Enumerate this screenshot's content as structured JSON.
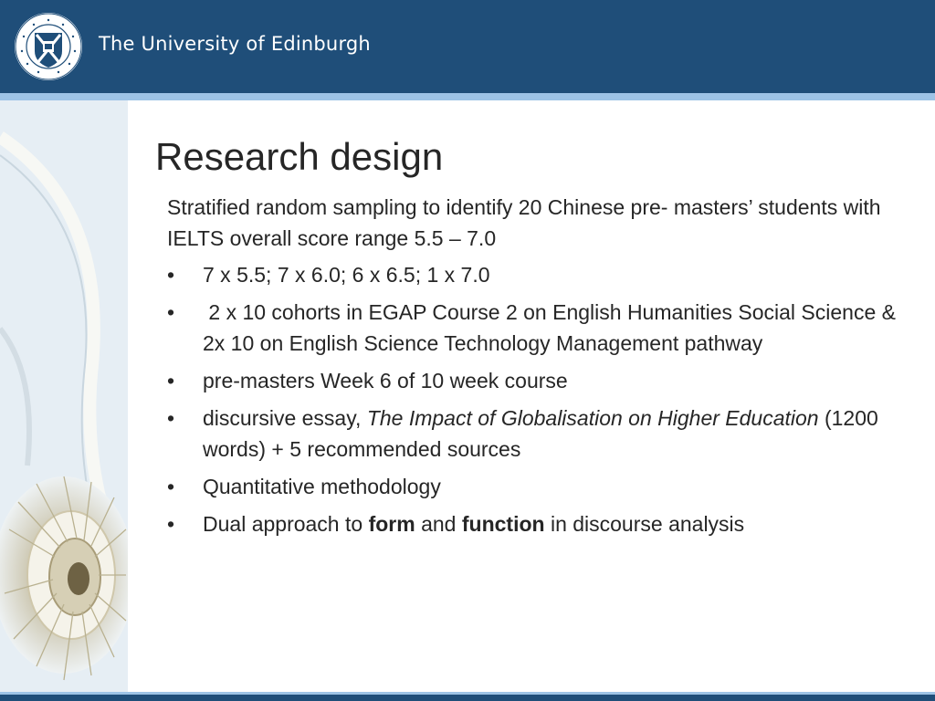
{
  "header": {
    "university_name": "The University of Edinburgh",
    "crest_ring_text": "THE UNIVERSITY OF EDINBURGH"
  },
  "slide": {
    "title": "Research design",
    "lead": "Stratified random sampling to identify 20 Chinese pre- masters’ students with IELTS overall score range 5.5 – 7.0",
    "bullet_symbol": "•",
    "bullets": {
      "b1": "7 x 5.5; 7 x 6.0; 6 x 6.5; 1 x 7.0",
      "b2": " 2 x 10 cohorts in EGAP Course 2 on English Humanities Social Science &  2x 10 on English Science Technology Management pathway",
      "b3": "pre-masters Week 6 of 10 week course",
      "b4_prefix": "discursive essay, ",
      "b4_italic": "The Impact of Globalisation on Higher Education",
      "b4_suffix": " (1200 words) + 5 recommended sources",
      "b5": "Quantitative methodology",
      "b6_prefix": "Dual approach to ",
      "b6_bold1": "form",
      "b6_mid": " and ",
      "b6_bold2": "function",
      "b6_suffix": " in discourse analysis"
    }
  },
  "colors": {
    "header_blue": "#1f4e79",
    "stripe_light_blue": "#9dc3e6",
    "text": "#262626"
  }
}
